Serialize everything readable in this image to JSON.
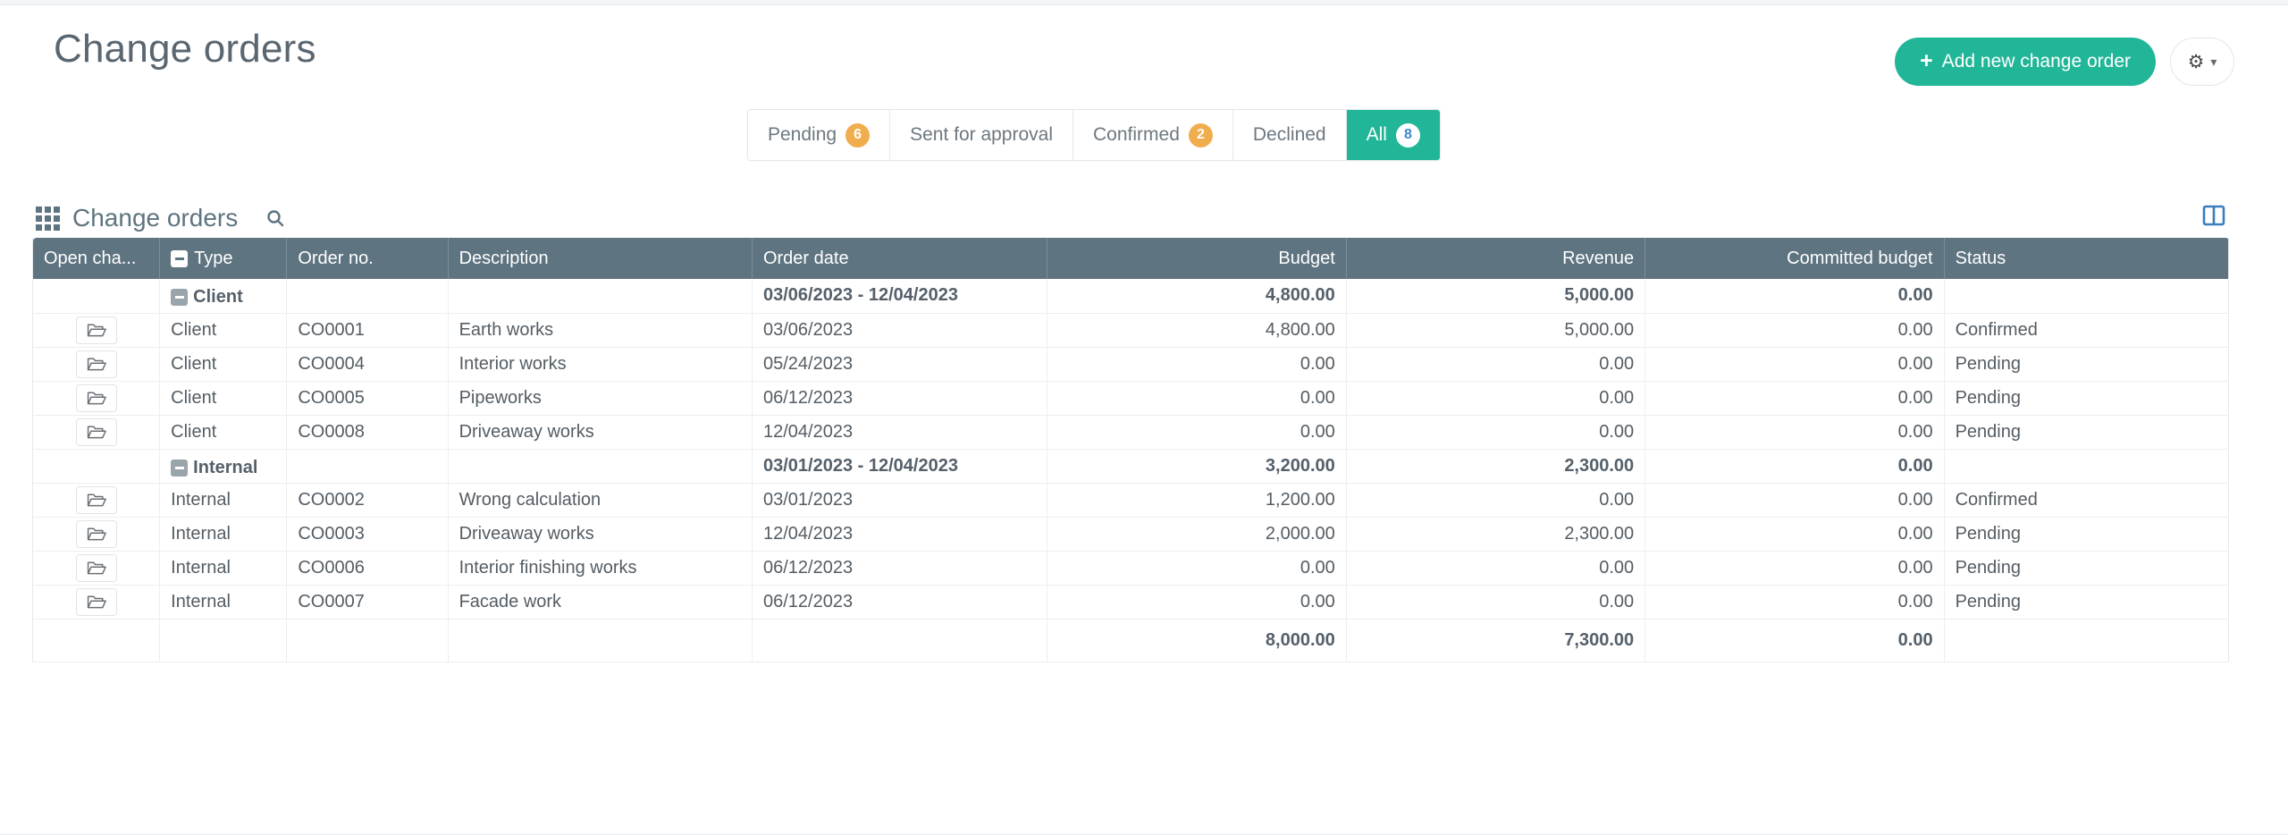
{
  "header": {
    "title": "Change orders",
    "add_button_label": "Add new change order",
    "add_button_plus": "+",
    "gear_icon": "gear-icon",
    "caret_icon": "chevron-down-icon",
    "accent_color": "#21b697"
  },
  "tabs": [
    {
      "label": "Pending",
      "badge": "6",
      "active": false
    },
    {
      "label": "Sent for approval",
      "badge": "",
      "active": false
    },
    {
      "label": "Confirmed",
      "badge": "2",
      "active": false
    },
    {
      "label": "Declined",
      "badge": "",
      "active": false
    },
    {
      "label": "All",
      "badge": "8",
      "active": true
    }
  ],
  "grid": {
    "caption": "Change orders",
    "grid_icon": "app-grid-icon",
    "search_icon": "search-icon",
    "split_view_icon": "split-pane-icon",
    "header_bg": "#5e7480",
    "columns": [
      {
        "label": "Open cha...",
        "align": "left",
        "collapse": false
      },
      {
        "label": "Type",
        "align": "left",
        "collapse": true
      },
      {
        "label": "Order no.",
        "align": "left",
        "collapse": false
      },
      {
        "label": "Description",
        "align": "left",
        "collapse": false
      },
      {
        "label": "Order date",
        "align": "left",
        "collapse": false
      },
      {
        "label": "Budget",
        "align": "right",
        "collapse": false
      },
      {
        "label": "Revenue",
        "align": "right",
        "collapse": false
      },
      {
        "label": "Committed budget",
        "align": "right",
        "collapse": false
      },
      {
        "label": "Status",
        "align": "left",
        "collapse": false
      }
    ],
    "rows": [
      {
        "kind": "group",
        "open": "",
        "type": "Client",
        "order_no": "",
        "description": "",
        "order_date": "03/06/2023 - 12/04/2023",
        "budget": "4,800.00",
        "revenue": "5,000.00",
        "committed_budget": "0.00",
        "status": ""
      },
      {
        "kind": "data",
        "open": "open-folder-icon",
        "type": "Client",
        "order_no": "CO0001",
        "description": "Earth works",
        "order_date": "03/06/2023",
        "budget": "4,800.00",
        "revenue": "5,000.00",
        "committed_budget": "0.00",
        "status": "Confirmed"
      },
      {
        "kind": "data",
        "open": "open-folder-icon",
        "type": "Client",
        "order_no": "CO0004",
        "description": "Interior works",
        "order_date": "05/24/2023",
        "budget": "0.00",
        "revenue": "0.00",
        "committed_budget": "0.00",
        "status": "Pending"
      },
      {
        "kind": "data",
        "open": "open-folder-icon",
        "type": "Client",
        "order_no": "CO0005",
        "description": "Pipeworks",
        "order_date": "06/12/2023",
        "budget": "0.00",
        "revenue": "0.00",
        "committed_budget": "0.00",
        "status": "Pending"
      },
      {
        "kind": "data",
        "open": "open-folder-icon",
        "type": "Client",
        "order_no": "CO0008",
        "description": "Driveaway works",
        "order_date": "12/04/2023",
        "budget": "0.00",
        "revenue": "0.00",
        "committed_budget": "0.00",
        "status": "Pending"
      },
      {
        "kind": "group",
        "open": "",
        "type": "Internal",
        "order_no": "",
        "description": "",
        "order_date": "03/01/2023 - 12/04/2023",
        "budget": "3,200.00",
        "revenue": "2,300.00",
        "committed_budget": "0.00",
        "status": ""
      },
      {
        "kind": "data",
        "open": "open-folder-icon",
        "type": "Internal",
        "order_no": "CO0002",
        "description": "Wrong calculation",
        "order_date": "03/01/2023",
        "budget": "1,200.00",
        "revenue": "0.00",
        "committed_budget": "0.00",
        "status": "Confirmed"
      },
      {
        "kind": "data",
        "open": "open-folder-icon",
        "type": "Internal",
        "order_no": "CO0003",
        "description": "Driveaway works",
        "order_date": "12/04/2023",
        "budget": "2,000.00",
        "revenue": "2,300.00",
        "committed_budget": "0.00",
        "status": "Pending"
      },
      {
        "kind": "data",
        "open": "open-folder-icon",
        "type": "Internal",
        "order_no": "CO0006",
        "description": "Interior finishing works",
        "order_date": "06/12/2023",
        "budget": "0.00",
        "revenue": "0.00",
        "committed_budget": "0.00",
        "status": "Pending"
      },
      {
        "kind": "data",
        "open": "open-folder-icon",
        "type": "Internal",
        "order_no": "CO0007",
        "description": "Facade work",
        "order_date": "06/12/2023",
        "budget": "0.00",
        "revenue": "0.00",
        "committed_budget": "0.00",
        "status": "Pending"
      },
      {
        "kind": "total",
        "open": "",
        "type": "",
        "order_no": "",
        "description": "",
        "order_date": "",
        "budget": "8,000.00",
        "revenue": "7,300.00",
        "committed_budget": "0.00",
        "status": ""
      }
    ]
  }
}
